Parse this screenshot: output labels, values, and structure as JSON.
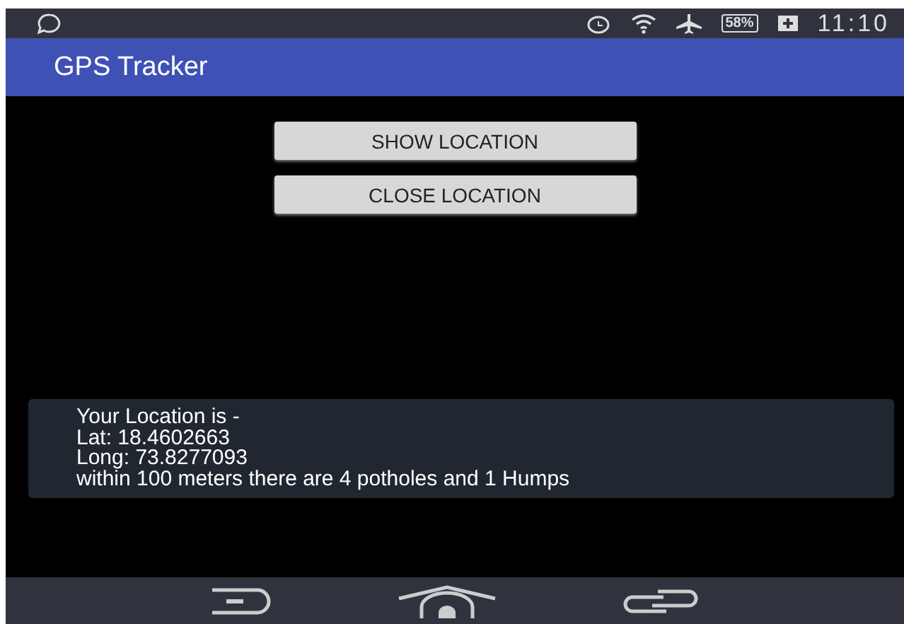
{
  "status_bar": {
    "battery": "58%",
    "time": "11:10"
  },
  "app_bar": {
    "title": "GPS Tracker"
  },
  "buttons": [
    "SHOW LOCATION",
    "CLOSE LOCATION"
  ],
  "toast": {
    "lines": [
      "Your Location is -",
      "Lat: 18.4602663",
      "Long: 73.8277093",
      "within 100 meters there are 4 potholes and 1 Humps"
    ]
  }
}
